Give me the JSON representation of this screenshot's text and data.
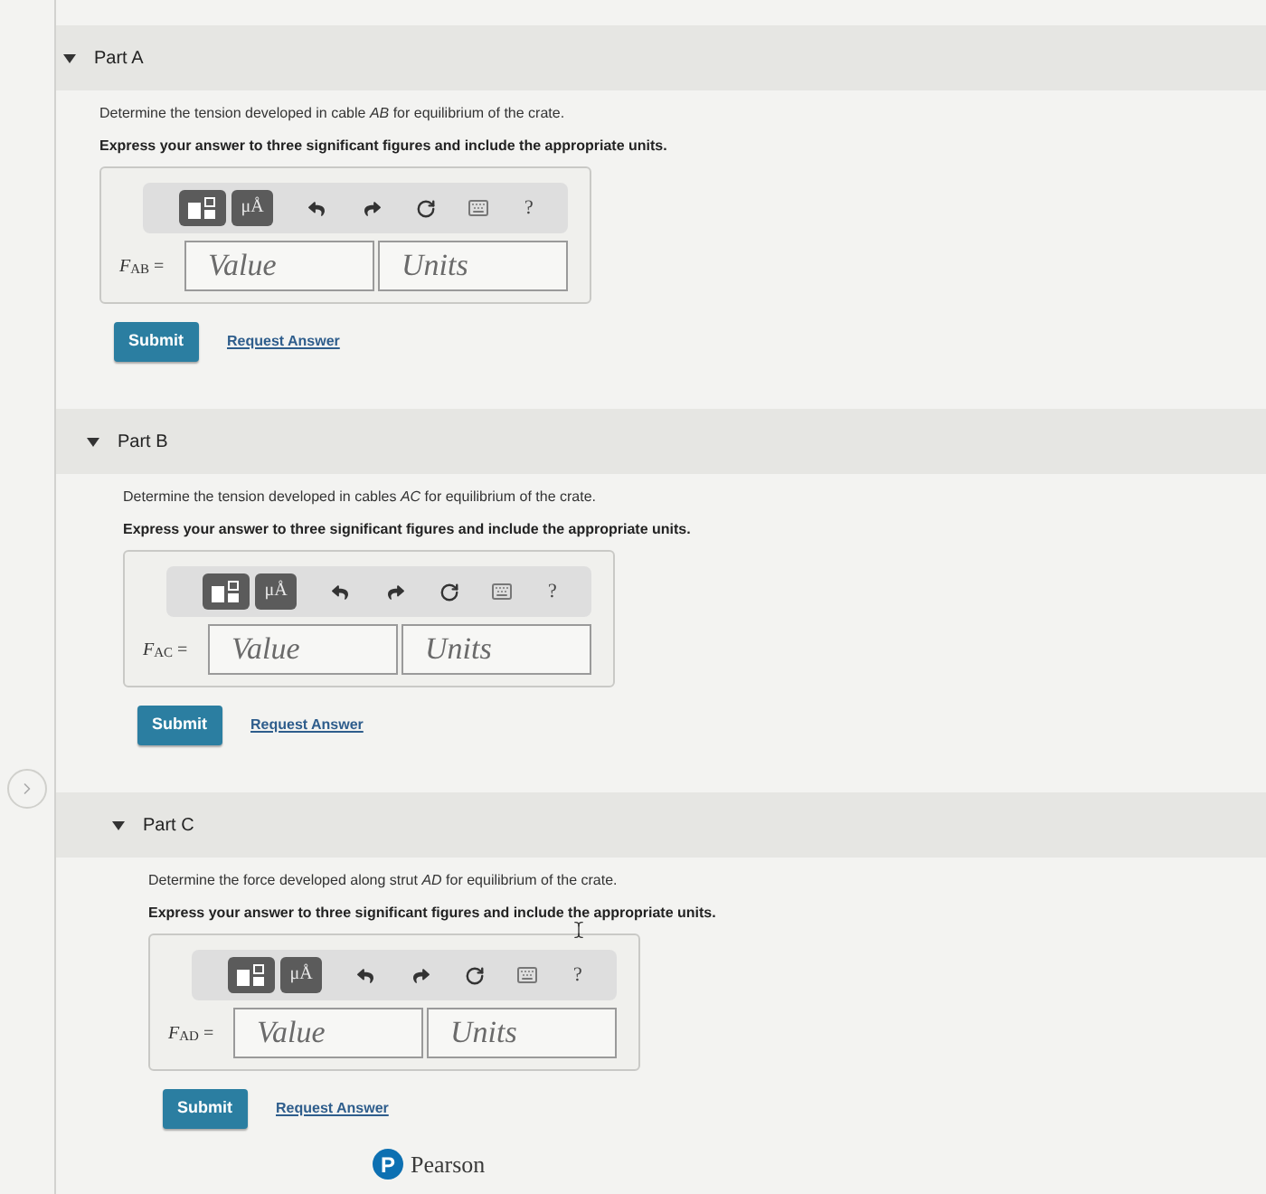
{
  "parts": [
    {
      "title": "Part A",
      "expanded": true,
      "question": "Determine the tension developed in cable *AB* for equilibrium of the crate.",
      "instruction": "Express your answer to three significant figures and include the appropriate units.",
      "toolbar": [
        {
          "kind": "templates"
        },
        {
          "kind": "symbols",
          "label": "μÅ"
        },
        {
          "kind": "undo"
        },
        {
          "kind": "redo"
        },
        {
          "kind": "reset"
        },
        {
          "kind": "keyboard"
        },
        {
          "kind": "help",
          "label": "?"
        }
      ],
      "answer_label": "*F*$_{AB}$ =",
      "value": {
        "placeholder": "Value"
      },
      "units": {
        "placeholder": "Units"
      },
      "buttons": [
        {
          "kind": "primary",
          "label": "Submit"
        },
        {
          "kind": "link",
          "label": "Request Answer"
        }
      ]
    },
    {
      "title": "Part B",
      "expanded": true,
      "question": "Determine the tension developed in cables *AC* for equilibrium of the crate.",
      "instruction": "Express your answer to three significant figures and include the appropriate units.",
      "toolbar": [
        {
          "kind": "templates"
        },
        {
          "kind": "symbols",
          "label": "μÅ"
        },
        {
          "kind": "undo"
        },
        {
          "kind": "redo"
        },
        {
          "kind": "reset"
        },
        {
          "kind": "keyboard"
        },
        {
          "kind": "help",
          "label": "?"
        }
      ],
      "answer_label": "*F*$_{AC}$ =",
      "value": {
        "placeholder": "Value"
      },
      "units": {
        "placeholder": "Units"
      },
      "buttons": [
        {
          "kind": "primary",
          "label": "Submit"
        },
        {
          "kind": "link",
          "label": "Request Answer"
        }
      ]
    },
    {
      "title": "Part C",
      "expanded": true,
      "question": "Determine the force developed along strut *AD* for equilibrium of the crate.",
      "instruction": "Express your answer to three significant figures and include the appropriate units.",
      "toolbar": [
        {
          "kind": "templates"
        },
        {
          "kind": "symbols",
          "label": "μÅ"
        },
        {
          "kind": "undo"
        },
        {
          "kind": "redo"
        },
        {
          "kind": "reset"
        },
        {
          "kind": "keyboard"
        },
        {
          "kind": "help",
          "label": "?"
        }
      ],
      "answer_label": "*F*$_{AD}$ =",
      "value": {
        "placeholder": "Value"
      },
      "units": {
        "placeholder": "Units"
      },
      "buttons": [
        {
          "kind": "primary",
          "label": "Submit"
        },
        {
          "kind": "link",
          "label": "Request Answer"
        }
      ],
      "text_cursor_visible": true
    }
  ],
  "footer": {
    "logo_letter": "P",
    "brand": "Pearson"
  }
}
